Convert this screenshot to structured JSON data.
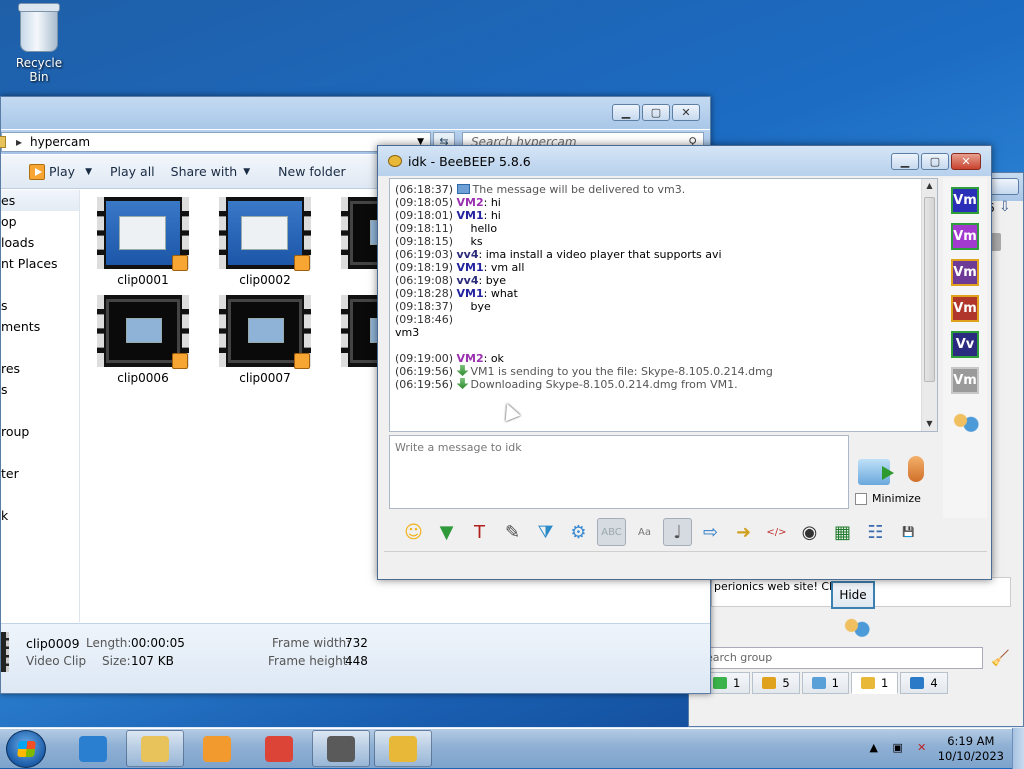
{
  "desktop": {
    "recycle_bin": "Recycle Bin"
  },
  "explorer": {
    "path": "hypercam",
    "search_placeholder": "Search hypercam",
    "toolbar": {
      "play": "Play",
      "play_all": "Play all",
      "share_with": "Share with",
      "new_folder": "New folder"
    },
    "nav_items": [
      "es",
      "op",
      "loads",
      "nt Places",
      "",
      "s",
      "ments",
      "",
      "res",
      "s",
      "",
      "roup",
      "",
      "ter",
      "",
      "k"
    ],
    "files": [
      {
        "name": "clip0001",
        "style": "desktop"
      },
      {
        "name": "clip0002",
        "style": "desktop"
      },
      {
        "name": "cl",
        "style": "dark"
      },
      {
        "name": "clip0006",
        "style": "dark"
      },
      {
        "name": "clip0007",
        "style": "dark"
      },
      {
        "name": "cl",
        "style": "dark"
      }
    ],
    "details": {
      "name": "clip0009",
      "type": "Video Clip",
      "length_label": "Length:",
      "length": "00:00:05",
      "size_label": "Size:",
      "size": "107 KB",
      "fw_label": "Frame width:",
      "fw": "732",
      "fh_label": "Frame height:",
      "fh": "448"
    }
  },
  "bee_chat": {
    "title": "idk - BeeBEEP 5.8.6",
    "lines": [
      {
        "time": "(06:18:37)",
        "icon": "mail",
        "user": "",
        "text": "The message will be delivered to vm3."
      },
      {
        "time": "(09:18:05)",
        "user": "VM2",
        "cls": "vm2",
        "text": ": hi"
      },
      {
        "time": "(09:18:01)",
        "user": "VM1",
        "cls": "vm1",
        "text": ": hi"
      },
      {
        "time": "(09:18:11)",
        "user": "",
        "text": "    hello"
      },
      {
        "time": "(09:18:15)",
        "user": "",
        "text": "    ks"
      },
      {
        "time": "(06:19:03)",
        "user": "vv4",
        "cls": "vv4",
        "text": ": ima install a video player that supports avi"
      },
      {
        "time": "(09:18:19)",
        "user": "VM1",
        "cls": "vm1",
        "text": ": vm all"
      },
      {
        "time": "(06:19:08)",
        "user": "vv4",
        "cls": "vv4",
        "text": ": bye"
      },
      {
        "time": "(09:18:28)",
        "user": "VM1",
        "cls": "vm1",
        "text": ": what"
      },
      {
        "time": "(09:18:37)",
        "user": "",
        "text": "    bye"
      },
      {
        "time": "(09:18:46)",
        "user": "",
        "text": ""
      },
      {
        "time": "",
        "user": "",
        "text": "vm3"
      },
      {
        "time": "",
        "user": "",
        "text": ""
      },
      {
        "time": "(09:19:00)",
        "user": "VM2",
        "cls": "vm2",
        "text": ": ok"
      },
      {
        "time": "(06:19:56)",
        "icon": "download",
        "user": "",
        "text": "VM1 is sending to you the file: Skype-8.105.0.214.dmg"
      },
      {
        "time": "(06:19:56)",
        "icon": "download",
        "user": "",
        "text": "Downloading Skype-8.105.0.214.dmg from VM1."
      }
    ],
    "input_placeholder": "Write a message to idk",
    "minimize_label": "Minimize",
    "side_users": [
      {
        "label": "Vm",
        "bg": "#2a2fb8",
        "border": "#2e9e3a"
      },
      {
        "label": "Vm",
        "bg": "#a23ad0",
        "border": "#2e9e3a"
      },
      {
        "label": "Vm",
        "bg": "#6d3a96",
        "border": "#e0a21c"
      },
      {
        "label": "Vm",
        "bg": "#b0362c",
        "border": "#e0a21c"
      },
      {
        "label": "Vv",
        "bg": "#2a2a80",
        "border": "#2e9e3a"
      },
      {
        "label": "Vm",
        "bg": "#9a9a9a",
        "border": "#c8c8c8"
      }
    ],
    "tools": [
      {
        "name": "emoticon",
        "glyph": "☺",
        "color": "#f2b21c"
      },
      {
        "name": "dropdown",
        "glyph": "▼",
        "color": "#2e9a3a"
      },
      {
        "name": "text-format",
        "glyph": "T",
        "color": "#b0201c"
      },
      {
        "name": "color-picker",
        "glyph": "✎",
        "color": "#4a4a4a"
      },
      {
        "name": "filter",
        "glyph": "⧩",
        "color": "#2a8ac8"
      },
      {
        "name": "settings",
        "glyph": "⚙",
        "color": "#3a8ad0"
      },
      {
        "name": "spellcheck",
        "glyph": "ABC",
        "color": "#9aa",
        "pressed": true
      },
      {
        "name": "dictionary",
        "glyph": "Aa",
        "color": "#777"
      },
      {
        "name": "note",
        "glyph": "♩",
        "color": "#555",
        "pressed": true
      },
      {
        "name": "send-file",
        "glyph": "⇨",
        "color": "#2a7ac8"
      },
      {
        "name": "send-folder",
        "glyph": "➜",
        "color": "#d0a020"
      },
      {
        "name": "html",
        "glyph": "</>",
        "color": "#c03030"
      },
      {
        "name": "screenshot",
        "glyph": "◉",
        "color": "#333"
      },
      {
        "name": "chart",
        "glyph": "▦",
        "color": "#1e7a2a"
      },
      {
        "name": "save-notes",
        "glyph": "☷",
        "color": "#3a6ab0"
      },
      {
        "name": "save",
        "glyph": "💾",
        "color": "#2a4aa0"
      }
    ]
  },
  "bee_main": {
    "partial_title": "6",
    "notice": "perionics web site! Click",
    "hide_label": "Hide",
    "search_group_placeholder": "earch group",
    "tabs": [
      {
        "count": "1",
        "color": "#3bb34a"
      },
      {
        "count": "5",
        "color": "#e0a21c"
      },
      {
        "count": "1",
        "color": "#5aa0d8"
      },
      {
        "count": "1",
        "color": "#e8b838",
        "active": true
      },
      {
        "count": "4",
        "color": "#2a7ac8"
      }
    ]
  },
  "taskbar": {
    "apps": [
      {
        "name": "ie",
        "color": "#2b7fd0",
        "open": false
      },
      {
        "name": "explorer",
        "color": "#e8c25a",
        "open": true
      },
      {
        "name": "media-player",
        "color": "#f29a2e",
        "open": false
      },
      {
        "name": "chrome",
        "color": "#db4437",
        "open": false
      },
      {
        "name": "hypercam",
        "color": "#5a5a5a",
        "open": true
      },
      {
        "name": "beebeep",
        "color": "#e8b838",
        "open": true
      }
    ],
    "time": "6:19 AM",
    "date": "10/10/2023"
  }
}
